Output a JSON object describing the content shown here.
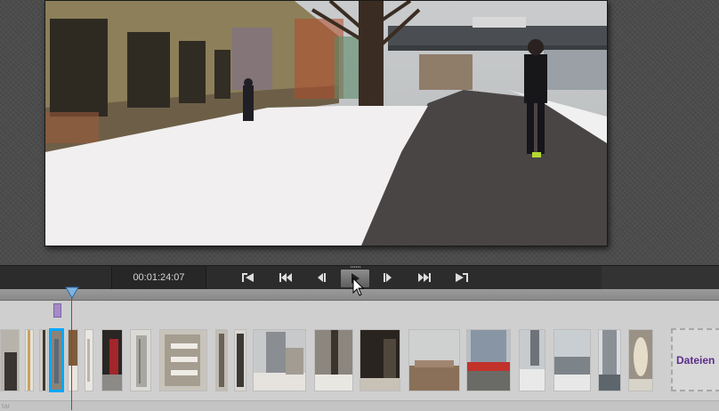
{
  "transport": {
    "timecode": "00:01:24:07",
    "buttons": [
      {
        "name": "go-to-start-button",
        "icon": "skip-to-start-icon"
      },
      {
        "name": "previous-clip-button",
        "icon": "previous-clip-icon"
      },
      {
        "name": "step-back-button",
        "icon": "step-back-icon"
      },
      {
        "name": "play-button",
        "icon": "play-icon",
        "active": true
      },
      {
        "name": "step-forward-button",
        "icon": "step-forward-icon"
      },
      {
        "name": "next-clip-button",
        "icon": "next-clip-icon"
      },
      {
        "name": "go-to-end-button",
        "icon": "skip-to-end-icon"
      }
    ]
  },
  "timeline": {
    "drop_zone_label": "Dateien",
    "footer_text": "tar",
    "thumbnails_count": 21,
    "playhead_color": "#e02020",
    "selection_color": "#00a8ff",
    "marker_color": "#a48ac6"
  }
}
